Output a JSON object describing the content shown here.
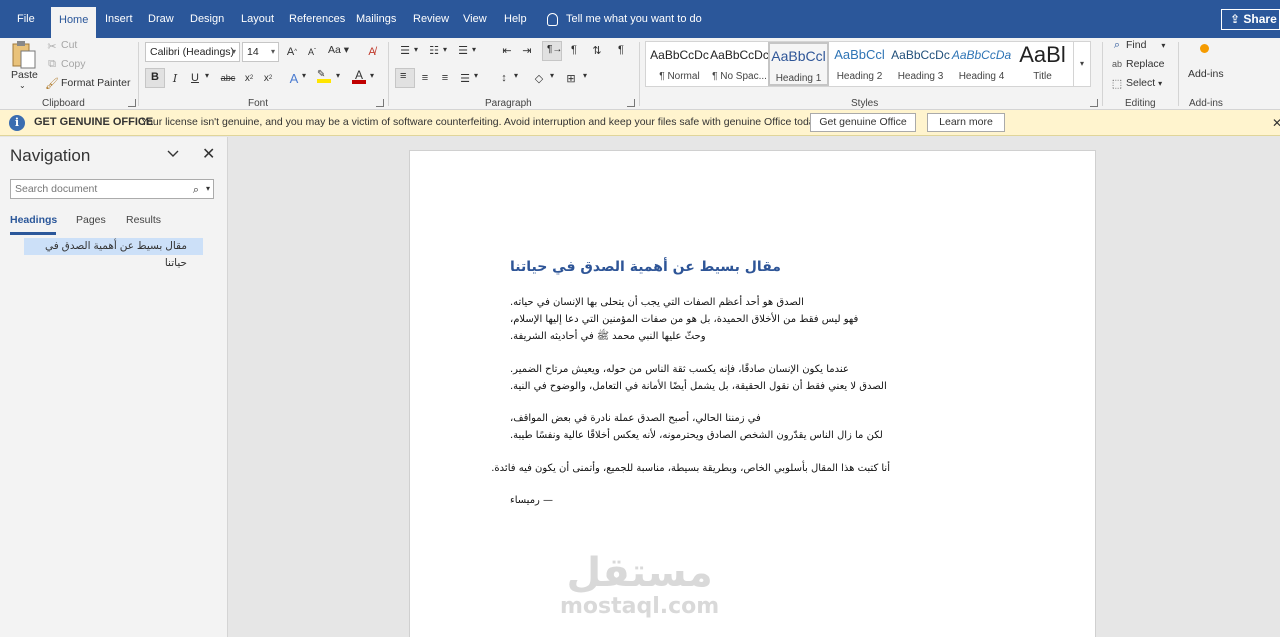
{
  "menu": {
    "tabs": [
      "File",
      "Home",
      "Insert",
      "Draw",
      "Design",
      "Layout",
      "References",
      "Mailings",
      "Review",
      "View",
      "Help"
    ],
    "tell_me": "Tell me what you want to do",
    "share": "Share"
  },
  "ribbon": {
    "clipboard": {
      "paste": "Paste",
      "cut": "Cut",
      "copy": "Copy",
      "format_painter": "Format Painter",
      "label": "Clipboard"
    },
    "font": {
      "family": "Calibri (Headings)",
      "size": "14",
      "change_case": "Aa",
      "label": "Font"
    },
    "paragraph": {
      "label": "Paragraph"
    },
    "styles": {
      "label": "Styles",
      "items": [
        {
          "preview": "AaBbCcDc",
          "name": "¶ Normal"
        },
        {
          "preview": "AaBbCcDc",
          "name": "¶ No Spac..."
        },
        {
          "preview": "AaBbCcl",
          "name": "Heading 1"
        },
        {
          "preview": "AaBbCcl",
          "name": "Heading 2"
        },
        {
          "preview": "AaBbCcDc",
          "name": "Heading 3"
        },
        {
          "preview": "AaBbCcDa",
          "name": "Heading 4"
        },
        {
          "preview": "AaBl",
          "name": "Title"
        }
      ]
    },
    "editing": {
      "find": "Find",
      "replace": "Replace",
      "select": "Select",
      "label": "Editing"
    },
    "addins": {
      "button": "Add-ins",
      "label": "Add-ins"
    }
  },
  "infobar": {
    "title": "GET GENUINE OFFICE",
    "message": "Your license isn't genuine, and you may be a victim of software counterfeiting. Avoid interruption and keep your files safe with genuine Office today.",
    "get_button": "Get genuine Office",
    "learn_button": "Learn more"
  },
  "navigation": {
    "title": "Navigation",
    "search_placeholder": "Search document",
    "tabs": [
      "Headings",
      "Pages",
      "Results"
    ],
    "heading_item": "مقال بسيط عن أهمية الصدق في حياتنا"
  },
  "document": {
    "title": "مقال بسيط عن أهمية الصدق في حياتنا",
    "paragraphs": [
      [
        "الصدق هو أحد أعظم الصفات التي يجب أن يتحلى بها الإنسان في حياته.",
        "فهو ليس فقط من الأخلاق الحميدة، بل هو من صفات المؤمنين التي دعا إليها الإسلام،",
        "وحثّ عليها النبي محمد ﷺ في أحاديثه الشريفة."
      ],
      [
        "عندما يكون الإنسان صادقًا، فإنه يكسب ثقة الناس من حوله، ويعيش مرتاح الضمير.",
        "الصدق لا يعني فقط أن نقول الحقيقة، بل يشمل أيضًا الأمانة في التعامل، والوضوح في النية."
      ],
      [
        "في زمننا الحالي، أصبح الصدق عملة نادرة في بعض المواقف،",
        "لكن ما زال الناس يقدّرون الشخص الصادق ويحترمونه، لأنه يعكس أخلاقًا عالية ونفسًا طيبة."
      ],
      [
        "أنا كتبت هذا المقال بأسلوبي الخاص، وبطريقة بسيطة، مناسبة للجميع، وأتمنى أن يكون فيه فائدة."
      ]
    ],
    "signature": "— رميساء"
  },
  "watermark": {
    "arabic": "مستقل",
    "latin": "mostaql.com"
  },
  "colors": {
    "brand": "#2b579a",
    "heading": "#2e5597",
    "infobar": "#fff4ce"
  }
}
